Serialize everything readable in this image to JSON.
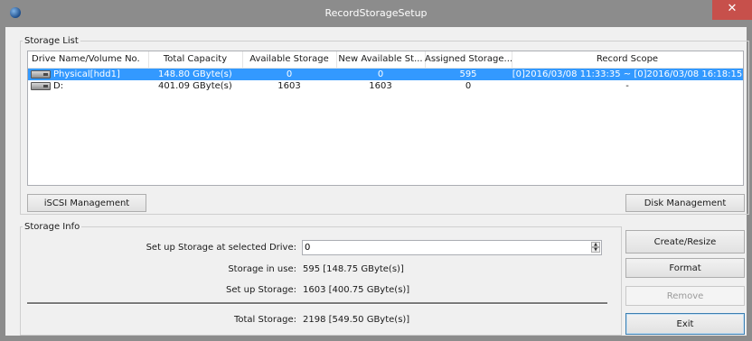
{
  "window": {
    "title": "RecordStorageSetup",
    "close_glyph": "✕"
  },
  "storage_list": {
    "legend": "Storage List",
    "columns": [
      "Drive Name/Volume No.",
      "Total Capacity",
      "Available Storage",
      "New Available St...",
      "Assigned Storage...",
      "Record Scope"
    ],
    "rows": [
      {
        "drive": "Physical[hdd1]",
        "total": "148.80 GByte(s)",
        "available": "0",
        "new_available": "0",
        "assigned": "595",
        "scope": "[0]2016/03/08 11:33:35 ~ [0]2016/03/08 16:18:15",
        "selected": true
      },
      {
        "drive": "D:",
        "total": "401.09 GByte(s)",
        "available": "1603",
        "new_available": "1603",
        "assigned": "0",
        "scope": "-",
        "selected": false
      }
    ]
  },
  "buttons": {
    "iscsi": "iSCSI Management",
    "disk": "Disk Management",
    "create": "Create/Resize",
    "format": "Format",
    "remove": "Remove",
    "exit": "Exit"
  },
  "storage_info": {
    "legend": "Storage Info",
    "setup_drive_label": "Set up Storage at selected Drive:",
    "setup_drive_value": "0",
    "in_use_label": "Storage in use:",
    "in_use_value": "595  [148.75 GByte(s)]",
    "setup_label": "Set up Storage:",
    "setup_value": "1603  [400.75 GByte(s)]",
    "total_label": "Total Storage:",
    "total_value": "2198  [549.50 GByte(s)]"
  },
  "colors": {
    "selection": "#3399ff",
    "titlebar": "#8c8c8c",
    "close": "#c7504b"
  }
}
